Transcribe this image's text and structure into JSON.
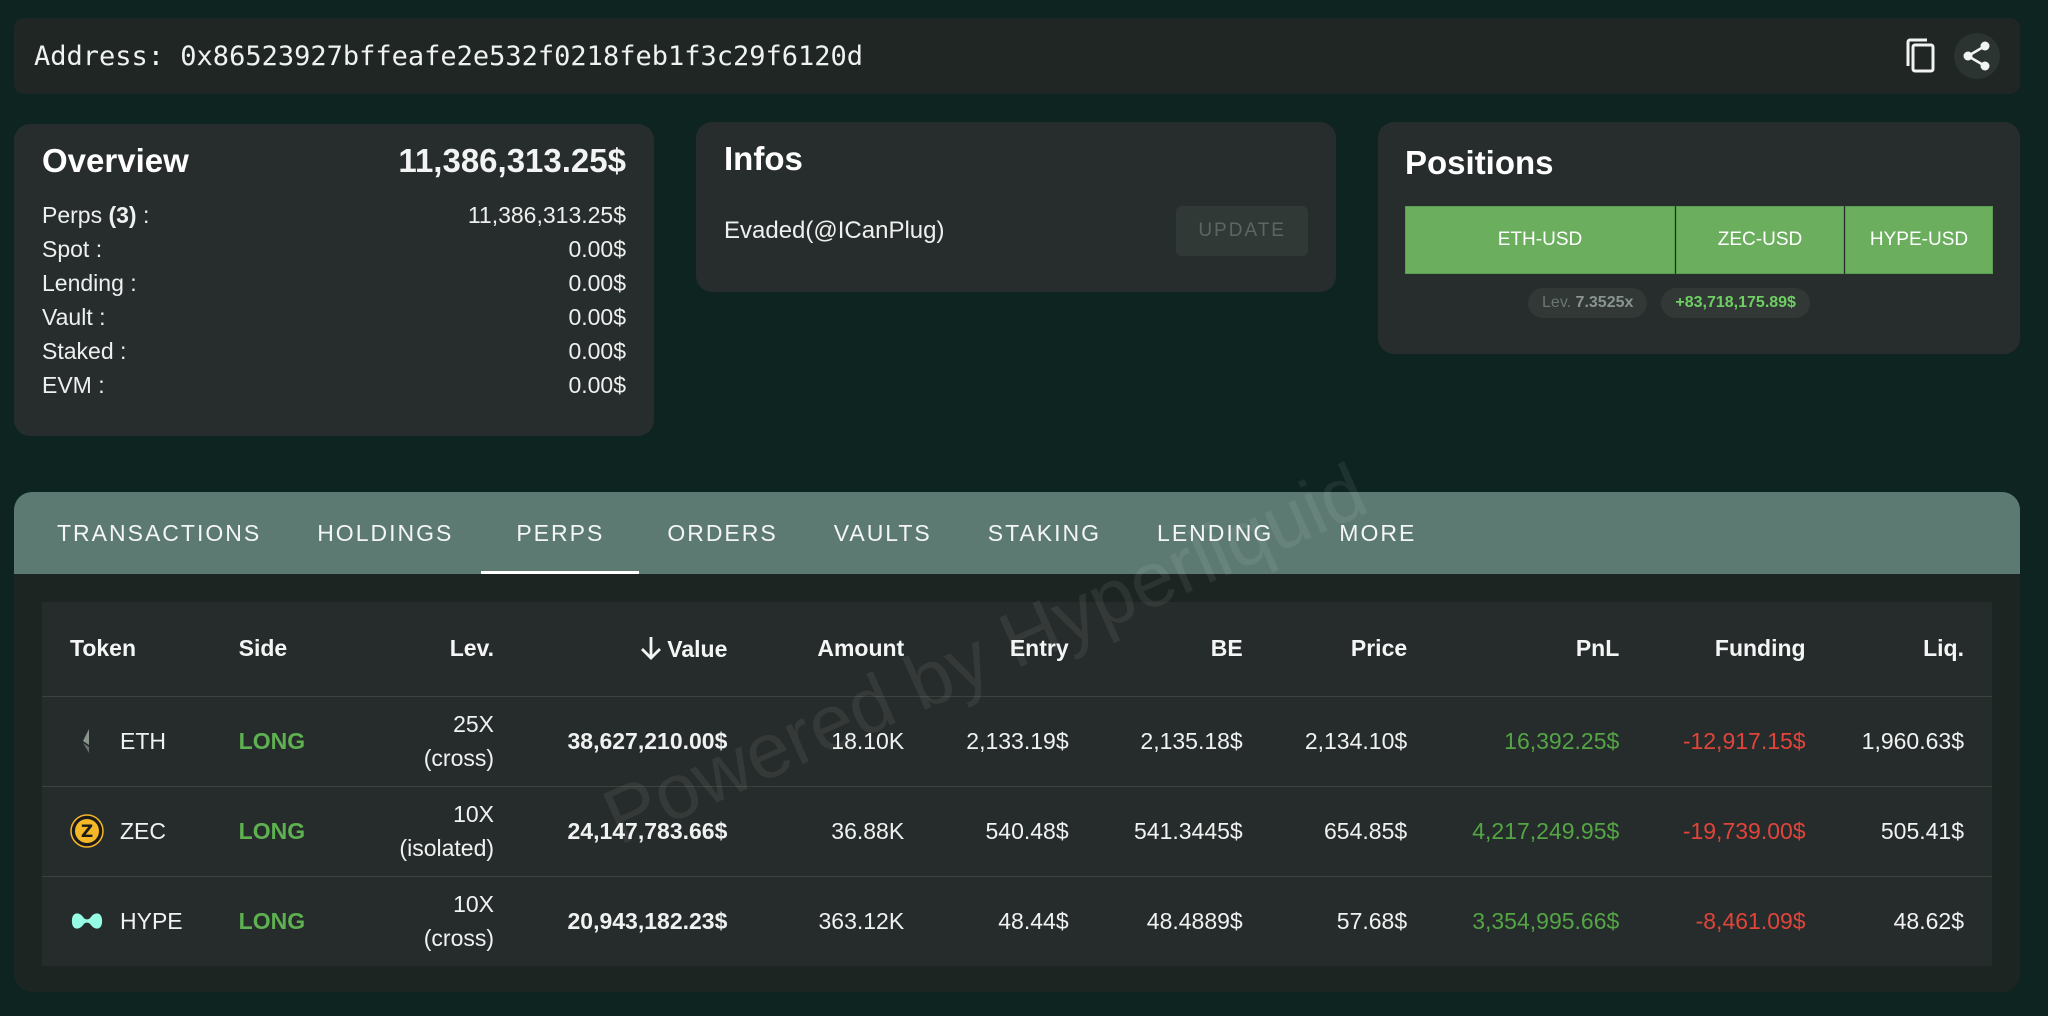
{
  "address": {
    "label": "Address: 0x86523927bffeafe2e532f0218feb1f3c29f6120d",
    "icons": [
      "copy-icon",
      "share-icon"
    ]
  },
  "overview": {
    "title": "Overview",
    "total": "11,386,313.25$",
    "perps_label": "Perps",
    "perps_count": "(3)",
    "perps_colon": " :",
    "rows": [
      {
        "label": "Spot :",
        "value": "0.00$"
      },
      {
        "label": "Lending :",
        "value": "0.00$"
      },
      {
        "label": "Vault :",
        "value": "0.00$"
      },
      {
        "label": "Staked :",
        "value": "0.00$"
      },
      {
        "label": "EVM :",
        "value": "0.00$"
      }
    ],
    "perps_value": "11,386,313.25$"
  },
  "infos": {
    "title": "Infos",
    "name": "Evaded(@ICanPlug)",
    "update_label": "UPDATE"
  },
  "positions": {
    "title": "Positions",
    "buttons": [
      "ETH-USD",
      "ZEC-USD",
      "HYPE-USD"
    ],
    "lev_label": "Lev.",
    "lev_value": "7.3525x",
    "pnl": "+83,718,175.89$"
  },
  "tabs": [
    "TRANSACTIONS",
    "HOLDINGS",
    "PERPS",
    "ORDERS",
    "VAULTS",
    "STAKING",
    "LENDING",
    "MORE"
  ],
  "active_tab": "PERPS",
  "table": {
    "headers": [
      "Token",
      "Side",
      "Lev.",
      "Value",
      "Amount",
      "Entry",
      "BE",
      "Price",
      "PnL",
      "Funding",
      "Liq."
    ],
    "sort_icon": "arrow-down-icon",
    "rows": [
      {
        "token": "ETH",
        "icon": "ethereum-icon",
        "side": "LONG",
        "lev": "25X",
        "margin": "(cross)",
        "value": "38,627,210.00$",
        "amount": "18.10K",
        "entry": "2,133.19$",
        "be": "2,135.18$",
        "price": "2,134.10$",
        "pnl": "16,392.25$",
        "funding": "-12,917.15$",
        "liq": "1,960.63$"
      },
      {
        "token": "ZEC",
        "icon": "zcash-icon",
        "side": "LONG",
        "lev": "10X",
        "margin": "(isolated)",
        "value": "24,147,783.66$",
        "amount": "36.88K",
        "entry": "540.48$",
        "be": "541.3445$",
        "price": "654.85$",
        "pnl": "4,217,249.95$",
        "funding": "-19,739.00$",
        "liq": "505.41$"
      },
      {
        "token": "HYPE",
        "icon": "hyperliquid-icon",
        "side": "LONG",
        "lev": "10X",
        "margin": "(cross)",
        "value": "20,943,182.23$",
        "amount": "363.12K",
        "entry": "48.44$",
        "be": "48.4889$",
        "price": "57.68$",
        "pnl": "3,354,995.66$",
        "funding": "-8,461.09$",
        "liq": "48.62$"
      }
    ]
  },
  "watermark": "Powered by Hyperliquid",
  "colors": {
    "background": "#0d2420",
    "card": "#272d2c",
    "tab_bar": "#5d7a72",
    "position_button": "#6aae5e",
    "long": "#5eb050",
    "pnl_positive": "#54a545",
    "funding_negative": "#e0443a"
  }
}
